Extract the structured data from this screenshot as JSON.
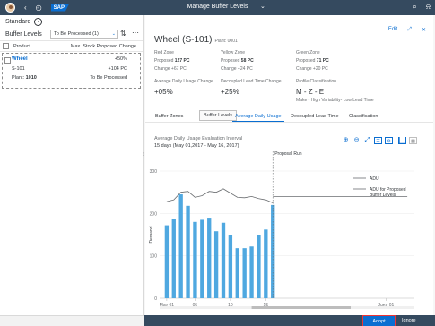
{
  "shell": {
    "title": "Manage Buffer Levels",
    "icons": [
      "avatar",
      "back-icon",
      "history-icon",
      "search-icon",
      "bell-icon"
    ]
  },
  "master": {
    "variant": "Standard",
    "list_title": "Buffer Levels",
    "filter_value": "To Be Processed (1)",
    "col_product": "Product",
    "col_change": "Max. Stock Proposed Change",
    "items": [
      {
        "material": "Wheel",
        "percent": "+50%",
        "id": "S-101",
        "qty": "+104 PC",
        "plant_label": "Plant:",
        "plant": "1010",
        "status": "To Be Processed"
      }
    ]
  },
  "detail": {
    "title": "Wheel (S-101)",
    "plant": "Plant: 0001",
    "edit": "Edit",
    "zones": {
      "red": {
        "title": "Red Zone",
        "proposed_label": "Proposed",
        "proposed": "127 PC",
        "change_label": "Change",
        "change": "+67 PC"
      },
      "yellow": {
        "title": "Yellow Zone",
        "proposed_label": "Proposed",
        "proposed": "58 PC",
        "change_label": "Change",
        "change": "+24 PC"
      },
      "green": {
        "title": "Green Zone",
        "proposed_label": "Proposed",
        "proposed": "71 PC",
        "change_label": "Change",
        "change": "+20 PC"
      }
    },
    "kpis": {
      "adu_change_label": "Average Daily Usage Change",
      "adu_change": "+05%",
      "dlt_change_label": "Decoupled Lead Time Change",
      "dlt_change": "+25%",
      "profile_label": "Profile Classification",
      "profile": "M - Z - E",
      "profile_desc": "Make - High Variability- Low Lead Time"
    },
    "tabs": [
      "Buffer Zones",
      "Buffer Levels",
      "Average Daily Usage",
      "Decoupled Lead Time",
      "Classification"
    ],
    "selected_tab": "Average Daily Usage"
  },
  "chart_data": {
    "type": "bar",
    "title": "Average Daily Usage Evaluation Interval",
    "subtitle": "15 days (May 01,2017 - May 16, 2017)",
    "ylabel": "Demand",
    "ylim": [
      0,
      300
    ],
    "y_ticks": [
      0,
      100,
      200,
      300
    ],
    "x_tick_labels": [
      {
        "label": "May 01",
        "day": 1
      },
      {
        "label": "05",
        "day": 5
      },
      {
        "label": "10",
        "day": 10
      },
      {
        "label": "15",
        "day": 15
      },
      {
        "label": "June 01",
        "day": 32
      }
    ],
    "annotation": "Proposal Run",
    "annotation_day": 16,
    "legend": {
      "placement": "right",
      "adu": "ADU",
      "proposed": "ADU for Proposed Buffer Levels"
    },
    "series": [
      {
        "name": "Demand",
        "color": "#4fa8e0",
        "x": [
          1,
          2,
          3,
          4,
          5,
          6,
          7,
          8,
          9,
          10,
          11,
          12,
          13,
          14,
          15,
          16
        ],
        "values": [
          172,
          188,
          245,
          218,
          180,
          185,
          190,
          158,
          178,
          150,
          118,
          118,
          122,
          150,
          162,
          220
        ]
      },
      {
        "name": "ADU",
        "color": "#6a6d70",
        "x": [
          1,
          2,
          3,
          4,
          5,
          6,
          7,
          8,
          9,
          10,
          11,
          12,
          13,
          14,
          15,
          16
        ],
        "values": [
          228,
          232,
          250,
          252,
          238,
          242,
          252,
          250,
          258,
          248,
          238,
          237,
          240,
          235,
          232,
          225
        ]
      },
      {
        "name": "ADU for Proposed Buffer Levels",
        "color": "#6a6d70",
        "x": [
          16,
          17,
          18,
          19,
          20,
          21,
          22,
          23,
          24,
          25,
          26,
          27,
          28,
          29,
          30,
          31,
          32,
          33,
          34,
          35
        ],
        "values": [
          240,
          240,
          240,
          240,
          240,
          240,
          240,
          240,
          240,
          240,
          240,
          240,
          240,
          240,
          240,
          240,
          240,
          240,
          240,
          240
        ]
      }
    ]
  },
  "footer": {
    "adopt": "Adopt",
    "ignore": "Ignore"
  }
}
